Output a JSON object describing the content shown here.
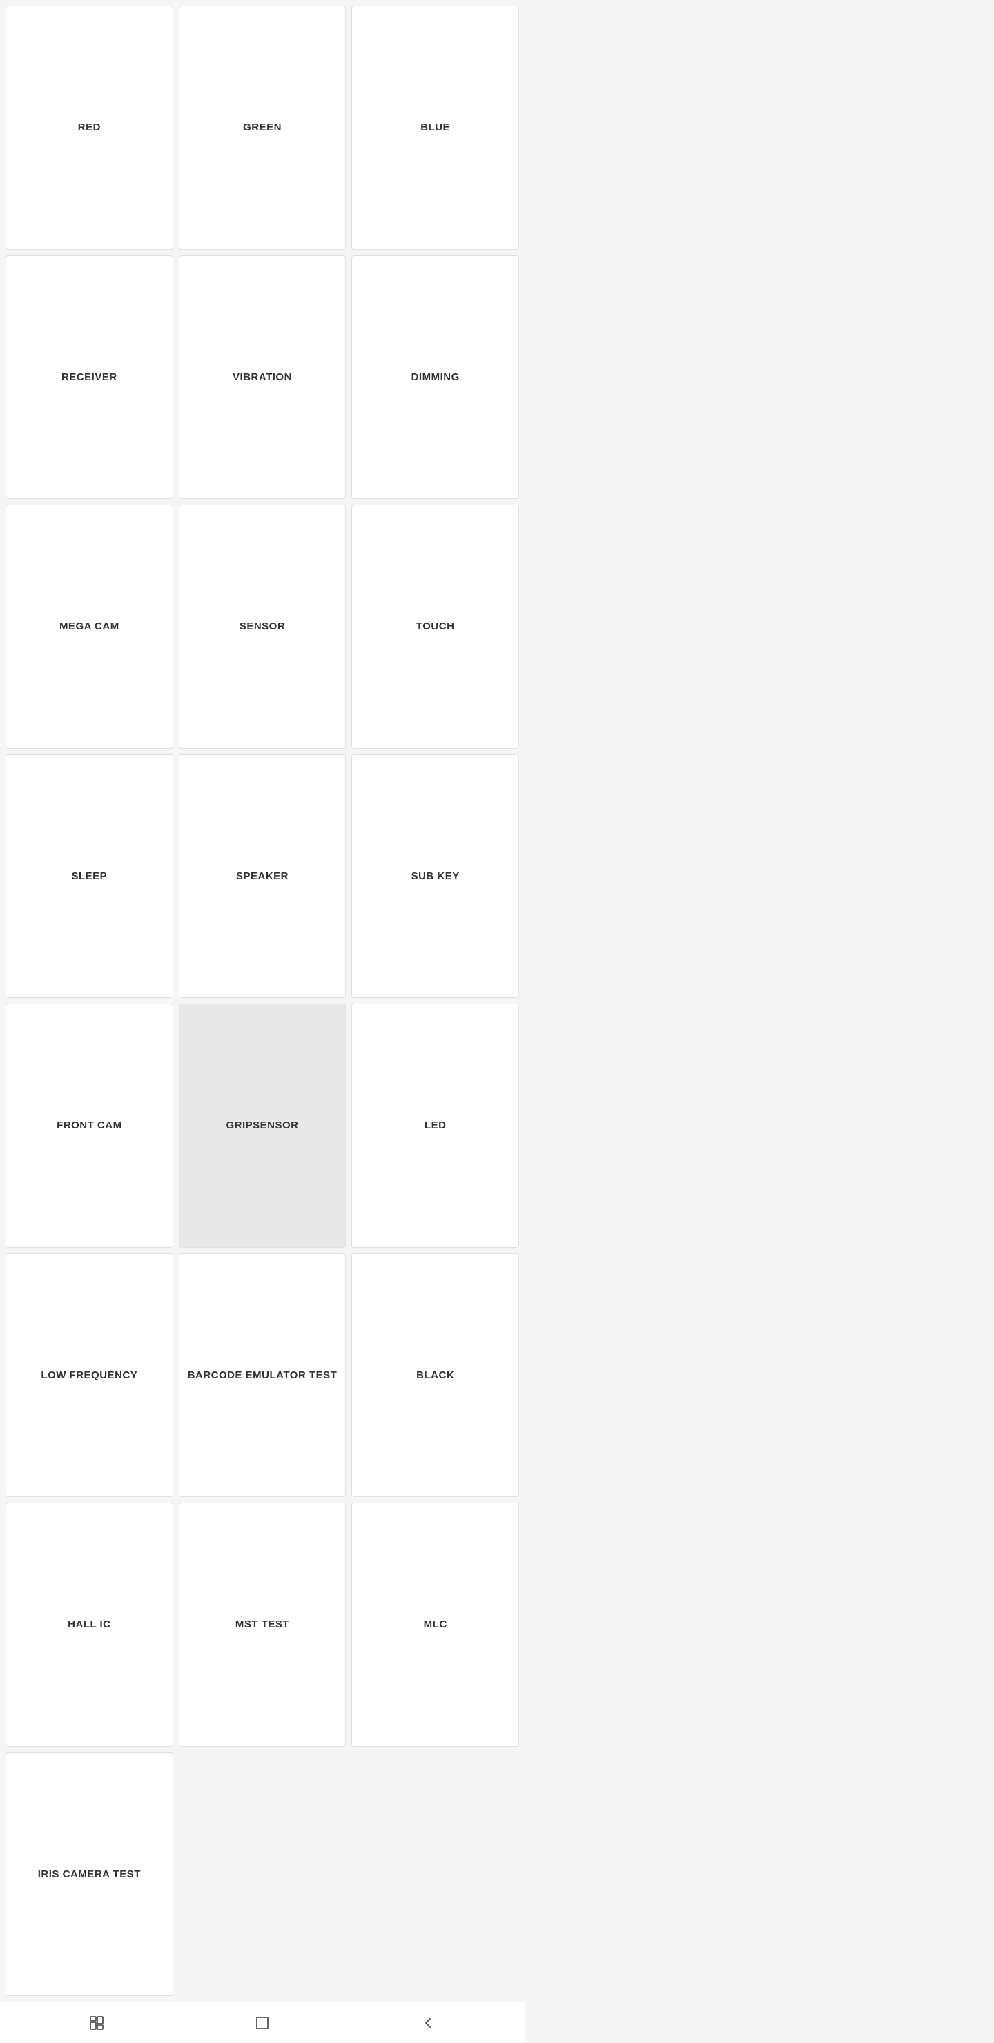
{
  "grid": {
    "items": [
      {
        "id": "red",
        "label": "RED",
        "highlighted": false
      },
      {
        "id": "green",
        "label": "GREEN",
        "highlighted": false
      },
      {
        "id": "blue",
        "label": "BLUE",
        "highlighted": false
      },
      {
        "id": "receiver",
        "label": "RECEIVER",
        "highlighted": false
      },
      {
        "id": "vibration",
        "label": "VIBRATION",
        "highlighted": false
      },
      {
        "id": "dimming",
        "label": "DIMMING",
        "highlighted": false
      },
      {
        "id": "mega-cam",
        "label": "MEGA CAM",
        "highlighted": false
      },
      {
        "id": "sensor",
        "label": "SENSOR",
        "highlighted": false
      },
      {
        "id": "touch",
        "label": "TOUCH",
        "highlighted": false
      },
      {
        "id": "sleep",
        "label": "SLEEP",
        "highlighted": false
      },
      {
        "id": "speaker",
        "label": "SPEAKER",
        "highlighted": false
      },
      {
        "id": "sub-key",
        "label": "SUB KEY",
        "highlighted": false
      },
      {
        "id": "front-cam",
        "label": "FRONT CAM",
        "highlighted": false
      },
      {
        "id": "gripsensor",
        "label": "GRIPSENSOR",
        "highlighted": true
      },
      {
        "id": "led",
        "label": "LED",
        "highlighted": false
      },
      {
        "id": "low-frequency",
        "label": "LOW FREQUENCY",
        "highlighted": false
      },
      {
        "id": "barcode-emulator-test",
        "label": "BARCODE EMULATOR TEST",
        "highlighted": false
      },
      {
        "id": "black",
        "label": "BLACK",
        "highlighted": false
      },
      {
        "id": "hall-ic",
        "label": "HALL IC",
        "highlighted": false
      },
      {
        "id": "mst-test",
        "label": "MST TEST",
        "highlighted": false
      },
      {
        "id": "mlc",
        "label": "MLC",
        "highlighted": false
      },
      {
        "id": "iris-camera-test",
        "label": "IRIS CAMERA TEST",
        "highlighted": false
      }
    ]
  },
  "nav": {
    "recent_label": "recent",
    "home_label": "home",
    "back_label": "back"
  }
}
